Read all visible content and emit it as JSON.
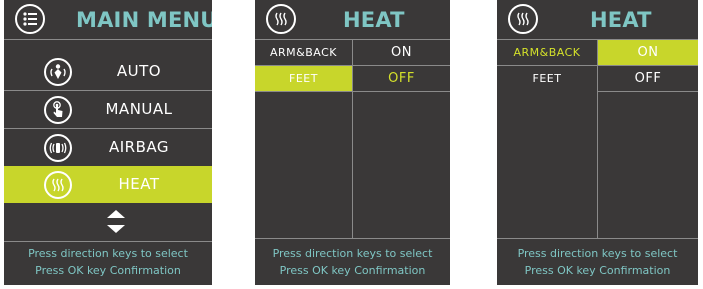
{
  "main_menu": {
    "title": "MAIN MENU",
    "header_icon": "list-icon",
    "items": [
      {
        "label": "AUTO",
        "icon": "auto-icon",
        "selected": false
      },
      {
        "label": "MANUAL",
        "icon": "manual-touch-icon",
        "selected": false
      },
      {
        "label": "AIRBAG",
        "icon": "airbag-icon",
        "selected": false
      },
      {
        "label": "HEAT",
        "icon": "heat-icon",
        "selected": true
      }
    ],
    "footer_line1": "Press direction keys to select",
    "footer_line2": "Press OK key Confirmation"
  },
  "heat_screen_feet": {
    "title": "HEAT",
    "header_icon": "heat-icon",
    "rows": [
      {
        "label": "ARM&BACK",
        "value": "ON",
        "selected": false
      },
      {
        "label": "FEET",
        "value": "OFF",
        "selected": true
      }
    ],
    "footer_line1": "Press direction keys to select",
    "footer_line2": "Press OK key Confirmation"
  },
  "heat_screen_armback": {
    "title": "HEAT",
    "header_icon": "heat-icon",
    "rows": [
      {
        "label": "ARM&BACK",
        "value": "ON",
        "selected": true
      },
      {
        "label": "FEET",
        "value": "OFF",
        "selected": false
      }
    ],
    "footer_line1": "Press direction keys to select",
    "footer_line2": "Press OK key Confirmation"
  },
  "colors": {
    "background": "#3a3838",
    "accent": "#c8d62b",
    "title": "#7fc6c4",
    "divider": "#8a8a8a"
  }
}
